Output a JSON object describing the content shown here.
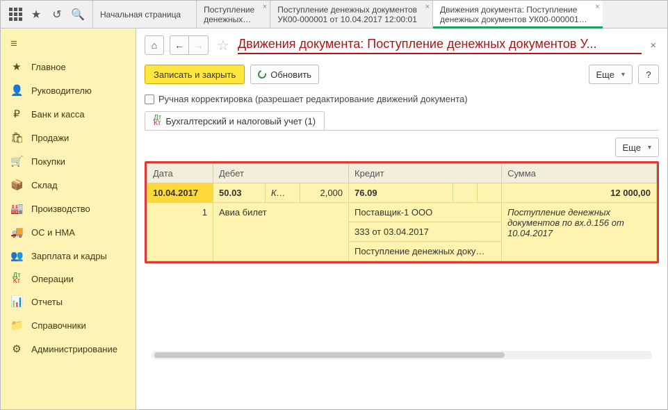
{
  "topTabs": {
    "t0": "Начальная страница",
    "t1a": "Поступление",
    "t1b": "денежных…",
    "t2a": "Поступление денежных документов",
    "t2b": "УК00-000001 от 10.04.2017 12:00:01",
    "t3a": "Движения документа: Поступление",
    "t3b": "денежных документов УК00-000001…"
  },
  "sidebar": {
    "items": [
      {
        "label": "Главное"
      },
      {
        "label": "Руководителю"
      },
      {
        "label": "Банк и касса"
      },
      {
        "label": "Продажи"
      },
      {
        "label": "Покупки"
      },
      {
        "label": "Склад"
      },
      {
        "label": "Производство"
      },
      {
        "label": "ОС и НМА"
      },
      {
        "label": "Зарплата и кадры"
      },
      {
        "label": "Операции"
      },
      {
        "label": "Отчеты"
      },
      {
        "label": "Справочники"
      },
      {
        "label": "Администрирование"
      }
    ]
  },
  "page": {
    "title": "Движения документа: Поступление денежных документов У...",
    "saveClose": "Записать и закрыть",
    "refresh": "Обновить",
    "more": "Еще",
    "help": "?",
    "manualEdit": "Ручная корректировка (разрешает редактирование движений документа)",
    "tabLabel": "Бухгалтерский и налоговый учет (1)"
  },
  "table": {
    "headers": {
      "date": "Дата",
      "debit": "Дебет",
      "credit": "Кредит",
      "sum": "Сумма"
    },
    "r1": {
      "date": "10.04.2017",
      "debAcct": "50.03",
      "debK": "К…",
      "debQty": "2,000",
      "credAcct": "76.09",
      "sum": "12 000,00"
    },
    "r2": {
      "n": "1",
      "debTxt": "Авиа билет",
      "cred1": "Поставщик-1 ООО",
      "cred2": "333 от 03.04.2017",
      "cred3": "Поступление денежных доку…",
      "sumTxt": "Поступление денежных документов по вх.д.156 от 10.04.2017"
    }
  }
}
